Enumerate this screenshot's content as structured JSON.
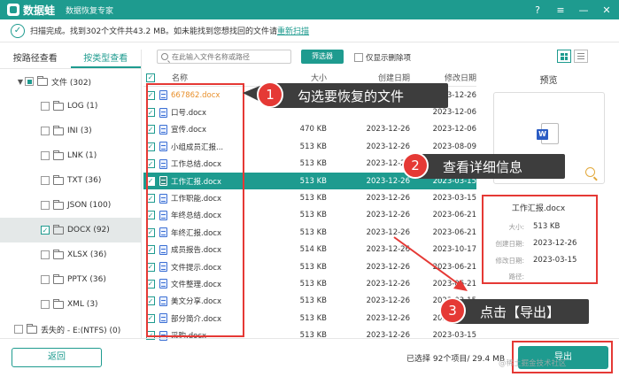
{
  "app": {
    "name": "数据蛙",
    "subtitle": "数据恢复专家"
  },
  "window_controls": [
    "?",
    "≡",
    "—",
    "✕"
  ],
  "status": {
    "text": "扫描完成。找到302个文件共43.2 MB。如未能找到您想找回的文件请",
    "link": "重新扫描"
  },
  "left_tabs": [
    "按路径查看",
    "按类型查看"
  ],
  "type_tree": {
    "root": "文件 (302)",
    "items": [
      {
        "label": "LOG (1)",
        "checked": false
      },
      {
        "label": "INI (3)",
        "checked": false
      },
      {
        "label": "LNK (1)",
        "checked": false
      },
      {
        "label": "TXT (36)",
        "checked": false
      },
      {
        "label": "JSON (100)",
        "checked": false
      },
      {
        "label": "DOCX (92)",
        "checked": true
      },
      {
        "label": "XLSX (36)",
        "checked": false
      },
      {
        "label": "PPTX (36)",
        "checked": false
      },
      {
        "label": "XML (3)",
        "checked": false
      }
    ],
    "lost": "丢失的 - E:(NTFS) (0)"
  },
  "toolbar": {
    "search_placeholder": "在此输入文件名称或路径",
    "filter_label": "筛选器",
    "deleted_only_label": "仅显示删除项"
  },
  "table": {
    "headers": [
      "名称",
      "大小",
      "创建日期",
      "修改日期"
    ],
    "rows": [
      {
        "name": "667862.docx",
        "size": "",
        "created": "",
        "modified": "2023-12-26",
        "orange": true
      },
      {
        "name": "口号.docx",
        "size": "",
        "created": "",
        "modified": "2023-12-06"
      },
      {
        "name": "宣传.docx",
        "size": "470 KB",
        "created": "2023-12-26",
        "modified": "2023-12-06"
      },
      {
        "name": "小组成员汇报...",
        "size": "513 KB",
        "created": "2023-12-26",
        "modified": "2023-08-09"
      },
      {
        "name": "工作总结.docx",
        "size": "513 KB",
        "created": "2023-12-26",
        "modified": "2023-03-15"
      },
      {
        "name": "工作汇报.docx",
        "size": "513 KB",
        "created": "2023-12-26",
        "modified": "2023-03-15",
        "selected": true
      },
      {
        "name": "工作职能.docx",
        "size": "513 KB",
        "created": "2023-12-26",
        "modified": "2023-03-15"
      },
      {
        "name": "年终总结.docx",
        "size": "513 KB",
        "created": "2023-12-26",
        "modified": "2023-06-21"
      },
      {
        "name": "年终汇报.docx",
        "size": "513 KB",
        "created": "2023-12-26",
        "modified": "2023-06-21"
      },
      {
        "name": "成员报告.docx",
        "size": "514 KB",
        "created": "2023-12-26",
        "modified": "2023-10-17"
      },
      {
        "name": "文件提示.docx",
        "size": "513 KB",
        "created": "2023-12-26",
        "modified": "2023-06-21"
      },
      {
        "name": "文件整理.docx",
        "size": "513 KB",
        "created": "2023-12-26",
        "modified": "2023-06-21"
      },
      {
        "name": "美文分享.docx",
        "size": "513 KB",
        "created": "2023-12-26",
        "modified": "2023-03-15"
      },
      {
        "name": "部分简介.docx",
        "size": "513 KB",
        "created": "2023-12-26",
        "modified": "2023-03-15"
      },
      {
        "name": "采购.docx",
        "size": "513 KB",
        "created": "2023-12-26",
        "modified": "2023-03-15"
      }
    ]
  },
  "preview": {
    "title": "预览",
    "file_name": "工作汇报.docx",
    "fields": [
      {
        "key": "大小:",
        "value": "513 KB"
      },
      {
        "key": "创建日期:",
        "value": "2023-12-26"
      },
      {
        "key": "修改日期:",
        "value": "2023-03-15"
      },
      {
        "key": "路径:",
        "value": ""
      }
    ]
  },
  "bottom": {
    "back_label": "返回",
    "selection_info": "已选择 92个项目/ 29.4 MB",
    "export_label": "导出"
  },
  "annotations": [
    {
      "num": "1",
      "text": "勾选要恢复的文件"
    },
    {
      "num": "2",
      "text": "查看详细信息"
    },
    {
      "num": "3",
      "text": "点击【导出】"
    }
  ],
  "watermark": "@稀土掘金技术社区",
  "colors": {
    "accent": "#1e9b8f",
    "highlight": "#e53935",
    "callout_bg": "#3d3d3d"
  }
}
